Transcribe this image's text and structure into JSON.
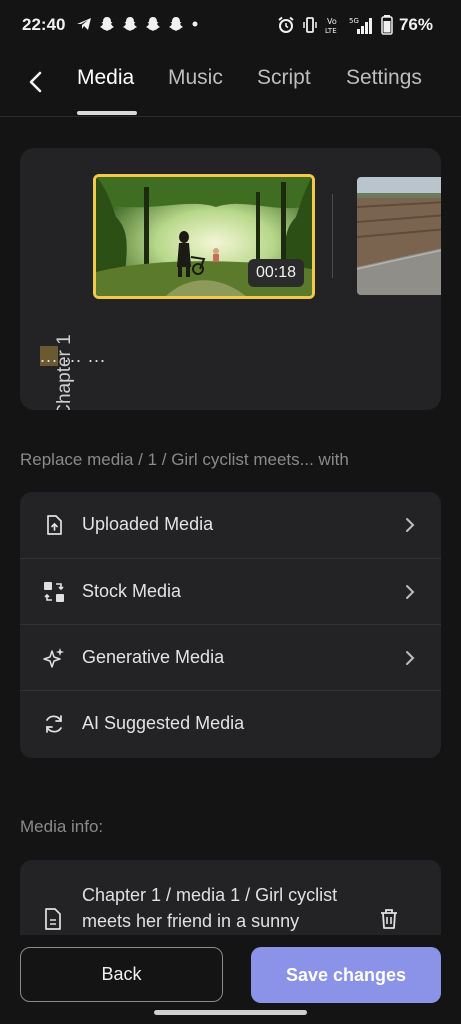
{
  "status_bar": {
    "time": "22:40",
    "left_icons": [
      "telegram-icon",
      "snapchat-icon",
      "snapchat-icon",
      "snapchat-icon",
      "snapchat-icon",
      "dot-icon"
    ],
    "right_icons": [
      "alarm-icon",
      "vibrate-icon",
      "volte-icon",
      "signal-5g-icon",
      "battery-icon"
    ],
    "volte_text": "Vo LTE",
    "network_text": "5G",
    "battery": "76%"
  },
  "nav": {
    "tabs": [
      {
        "label": "Media",
        "active": true
      },
      {
        "label": "Music",
        "active": false
      },
      {
        "label": "Script",
        "active": false
      },
      {
        "label": "Settings",
        "active": false
      }
    ]
  },
  "chapter": {
    "label": "Chapter 1",
    "media": [
      {
        "duration": "00:18",
        "selected": true
      },
      {
        "selected": false
      }
    ],
    "caption_highlight": "...",
    "caption_rest": " ... ..."
  },
  "replace": {
    "label": "Replace media / 1 / Girl cyclist meets... with",
    "options": [
      {
        "label": "Uploaded Media",
        "icon": "upload-file-icon",
        "chevron": true
      },
      {
        "label": "Stock Media",
        "icon": "stock-media-icon",
        "chevron": true
      },
      {
        "label": "Generative Media",
        "icon": "sparkle-icon",
        "chevron": true
      },
      {
        "label": "AI Suggested Media",
        "icon": "refresh-icon",
        "chevron": false
      }
    ]
  },
  "media_info": {
    "label": "Media info:",
    "text": "Chapter 1 / media 1 / Girl cyclist meets her friend in a sunny"
  },
  "footer": {
    "back_label": "Back",
    "save_label": "Save changes"
  },
  "colors": {
    "background": "#141414",
    "card": "#232325",
    "selected_border": "#f2c94c",
    "save_button": "#8b93e8"
  }
}
